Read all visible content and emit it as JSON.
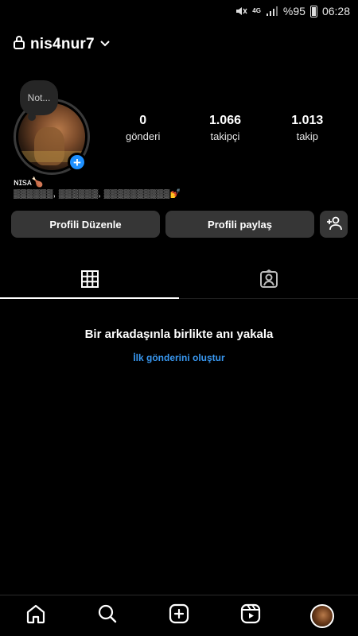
{
  "status_bar": {
    "network": "4G",
    "battery": "%95",
    "time": "06:28"
  },
  "header": {
    "username": "nis4nur7"
  },
  "profile": {
    "note": "Not...",
    "stats": [
      {
        "value": "0",
        "label": "gönderi"
      },
      {
        "value": "1.066",
        "label": "takipçi"
      },
      {
        "value": "1.013",
        "label": "takip"
      }
    ],
    "bio_name": "ɴɪsᴀ🍗",
    "bio_text": "▒▒▒▒▒▒, ▒▒▒▒▒▒, ▒▒▒▒▒▒▒▒▒▒💅"
  },
  "buttons": {
    "edit": "Profili Düzenle",
    "share": "Profili paylaş"
  },
  "empty_state": {
    "title": "Bir arkadaşınla birlikte anı yakala",
    "link": "İlk gönderini oluştur"
  },
  "icons": {
    "lock": "lock-icon",
    "chevron": "chevron-down-icon",
    "grid": "grid-icon",
    "tagged": "tagged-icon",
    "home": "home-icon",
    "search": "search-icon",
    "create": "create-icon",
    "reels": "reels-icon"
  },
  "colors": {
    "background": "#000000",
    "button": "#363636",
    "link": "#3897f0",
    "add_story": "#1e90ff"
  }
}
